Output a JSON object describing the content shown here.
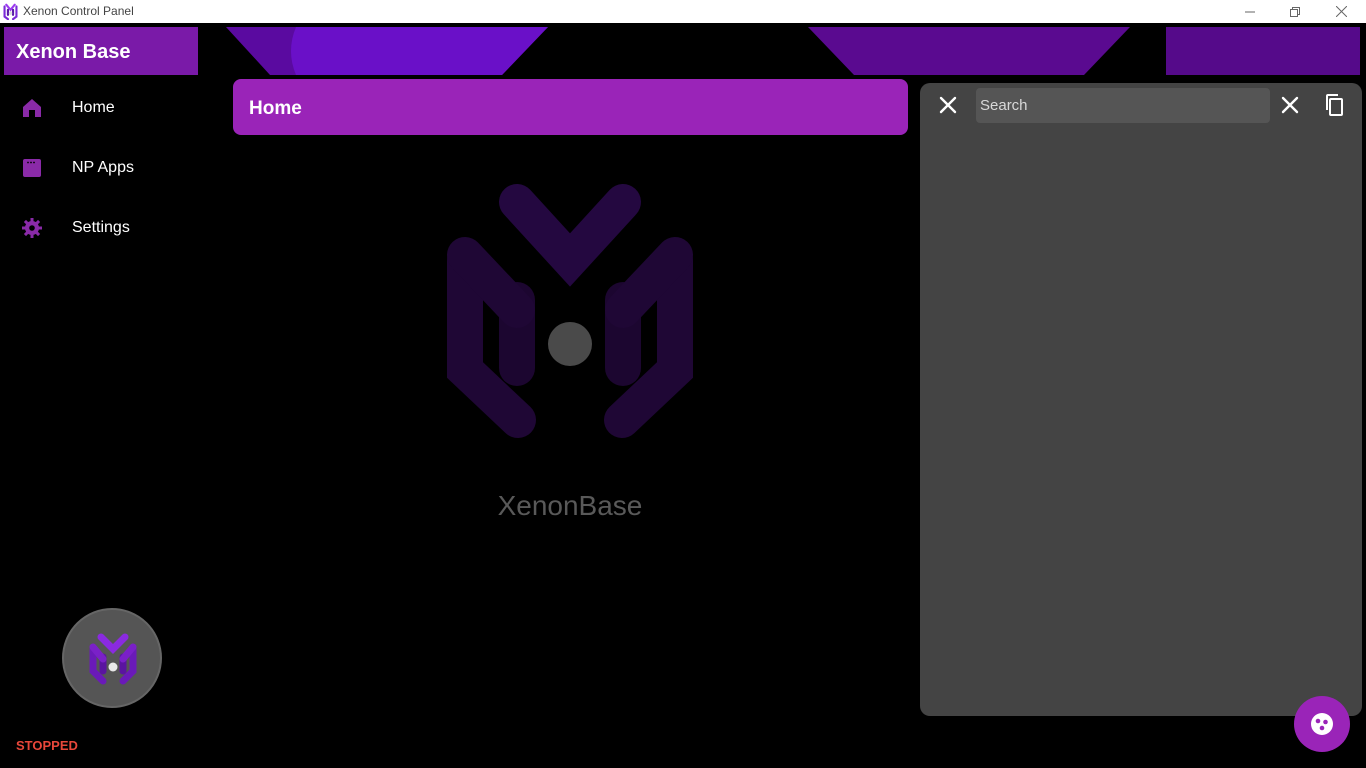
{
  "window": {
    "title": "Xenon Control Panel",
    "icon": "xenon-logo-icon"
  },
  "sidebar": {
    "brand": "Xenon Base",
    "items": [
      {
        "label": "Home",
        "icon": "home-icon"
      },
      {
        "label": "NP Apps",
        "icon": "apps-icon"
      },
      {
        "label": "Settings",
        "icon": "gear-icon"
      }
    ],
    "status": "STOPPED"
  },
  "main": {
    "header_title": "Home",
    "logo_text": "XenonBase"
  },
  "panel": {
    "search_placeholder": "Search"
  },
  "colors": {
    "accent": "#9a24b8",
    "brand_bg": "#7a1aa8",
    "status_stopped": "#e8473a",
    "panel_bg": "#444444"
  }
}
